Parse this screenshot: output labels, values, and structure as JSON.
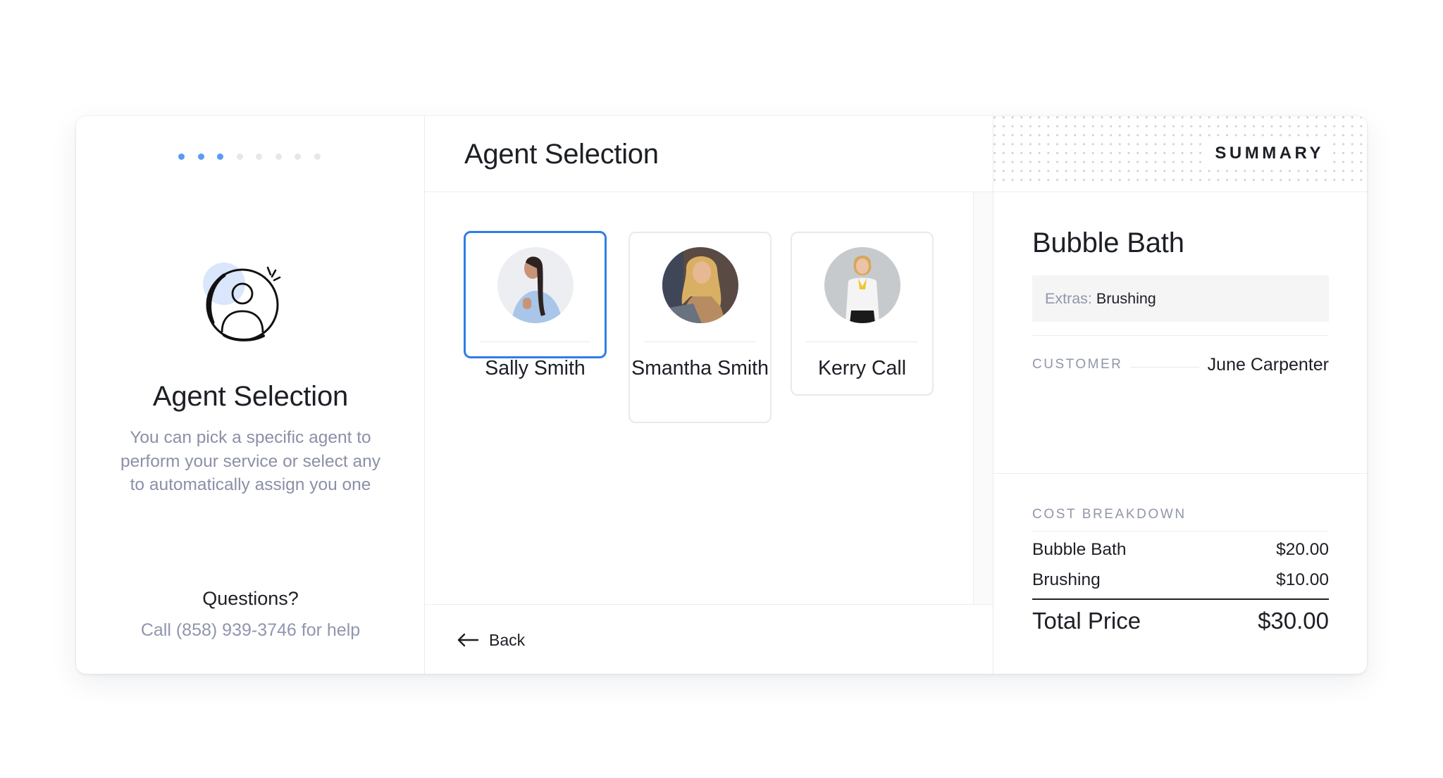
{
  "steps": {
    "total": 8,
    "completed": 3,
    "active_color": "#5b9af5",
    "inactive_color": "#e6e7ea"
  },
  "sidebar": {
    "icon": "user-circle-icon",
    "title": "Agent Selection",
    "description": "You can pick a specific agent to perform your service or select any to automatically assign you one",
    "questions_title": "Questions?",
    "questions_text": "Call (858) 939-3746 for help"
  },
  "main": {
    "title": "Agent Selection",
    "agents": [
      {
        "name": "Sally Smith",
        "selected": true,
        "avatar": "portrait-woman-braid-blue-shirt"
      },
      {
        "name": "Smantha Smith",
        "selected": false,
        "avatar": "portrait-woman-blonde-laptop"
      },
      {
        "name": "Kerry Call",
        "selected": false,
        "avatar": "portrait-woman-white-blouse-yellow-bow"
      }
    ],
    "back_label": "Back",
    "back_icon": "arrow-left-icon",
    "accent_color": "#2f7de8"
  },
  "summary": {
    "header_label": "SUMMARY",
    "service_title": "Bubble Bath",
    "extras_label": "Extras:",
    "extras_value": "Brushing",
    "customer_label": "CUSTOMER",
    "customer_name": "June Carpenter",
    "cost_title": "COST BREAKDOWN",
    "cost_items": [
      {
        "label": "Bubble Bath",
        "amount": "$20.00"
      },
      {
        "label": "Brushing",
        "amount": "$10.00"
      }
    ],
    "total_label": "Total Price",
    "total_amount": "$30.00"
  }
}
